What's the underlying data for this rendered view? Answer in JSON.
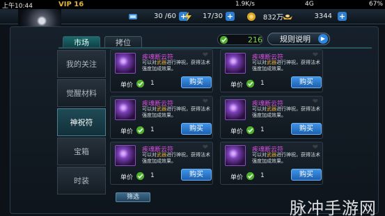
{
  "status_bar": {
    "time": "上午10:44",
    "speed": "1.9K/s",
    "network": "4G",
    "battery": "67%"
  },
  "player": {
    "vip": "VIP 16"
  },
  "resources": [
    {
      "icon": "stamina-icon",
      "value": "30 /60"
    },
    {
      "icon": "energy-icon",
      "value": "17/30"
    },
    {
      "icon": "coin-icon",
      "value": "832万"
    },
    {
      "icon": "ingot-icon",
      "value": "3344"
    }
  ],
  "tabs": [
    {
      "label": "市场"
    },
    {
      "label": "拷位"
    }
  ],
  "gem_balance": "216",
  "rules_button": "规则说明",
  "sidebar": [
    {
      "label": "我的关注"
    },
    {
      "label": "觉醒材料"
    },
    {
      "label": "神祝符"
    },
    {
      "label": "宝箱"
    },
    {
      "label": "时装"
    }
  ],
  "item_card": {
    "name": "疾魂断云符",
    "desc_before": "可以对",
    "desc_highlight": "武器",
    "desc_after": "进行神祝，获得法术强度加成效果。",
    "price_label": "单价",
    "price": "1",
    "buy_label": "购买"
  },
  "filter_button": "筛选",
  "watermark": "脉冲手游网",
  "colors": {
    "buy_button": "#2e7dd6",
    "item_name": "#d84fe0",
    "gem": "#7ddb4a",
    "highlight": "#e0a83a"
  }
}
